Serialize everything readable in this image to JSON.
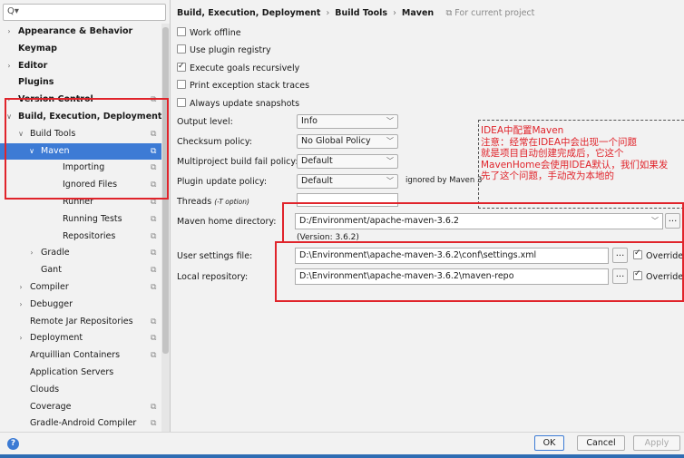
{
  "search": {
    "icon": "search-icon",
    "value": ""
  },
  "tree": [
    {
      "label": "Appearance & Behavior",
      "indent": 0,
      "arrow": "right",
      "bold": true
    },
    {
      "label": "Keymap",
      "indent": 0,
      "arrow": "",
      "bold": true
    },
    {
      "label": "Editor",
      "indent": 0,
      "arrow": "right",
      "bold": true
    },
    {
      "label": "Plugins",
      "indent": 0,
      "arrow": "",
      "bold": true
    },
    {
      "label": "Version Control",
      "indent": 0,
      "arrow": "right",
      "bold": true,
      "page_icon": true
    },
    {
      "label": "Build, Execution, Deployment",
      "indent": 0,
      "arrow": "down",
      "bold": true
    },
    {
      "label": "Build Tools",
      "indent": 1,
      "arrow": "down",
      "page_icon": true
    },
    {
      "label": "Maven",
      "indent": 2,
      "arrow": "down",
      "page_icon": true,
      "selected": true
    },
    {
      "label": "Importing",
      "indent": 3,
      "arrow": "",
      "page_icon": true
    },
    {
      "label": "Ignored Files",
      "indent": 3,
      "arrow": "",
      "page_icon": true
    },
    {
      "label": "Runner",
      "indent": 3,
      "arrow": "",
      "page_icon": true
    },
    {
      "label": "Running Tests",
      "indent": 3,
      "arrow": "",
      "page_icon": true
    },
    {
      "label": "Repositories",
      "indent": 3,
      "arrow": "",
      "page_icon": true
    },
    {
      "label": "Gradle",
      "indent": 2,
      "arrow": "right",
      "page_icon": true
    },
    {
      "label": "Gant",
      "indent": 2,
      "arrow": "",
      "page_icon": true
    },
    {
      "label": "Compiler",
      "indent": 1,
      "arrow": "right",
      "page_icon": true
    },
    {
      "label": "Debugger",
      "indent": 1,
      "arrow": "right"
    },
    {
      "label": "Remote Jar Repositories",
      "indent": 1,
      "arrow": "",
      "page_icon": true
    },
    {
      "label": "Deployment",
      "indent": 1,
      "arrow": "right",
      "page_icon": true
    },
    {
      "label": "Arquillian Containers",
      "indent": 1,
      "arrow": "",
      "page_icon": true
    },
    {
      "label": "Application Servers",
      "indent": 1,
      "arrow": ""
    },
    {
      "label": "Clouds",
      "indent": 1,
      "arrow": ""
    },
    {
      "label": "Coverage",
      "indent": 1,
      "arrow": "",
      "page_icon": true
    },
    {
      "label": "Gradle-Android Compiler",
      "indent": 1,
      "arrow": "",
      "page_icon": true
    }
  ],
  "breadcrumb": {
    "items": [
      "Build, Execution, Deployment",
      "Build Tools",
      "Maven"
    ],
    "scope": "For current project",
    "scope_icon": "project-icon"
  },
  "options": [
    {
      "label": "Work offline",
      "checked": false
    },
    {
      "label": "Use plugin registry",
      "checked": false
    },
    {
      "label": "Execute goals recursively",
      "checked": true
    },
    {
      "label": "Print exception stack traces",
      "checked": false
    },
    {
      "label": "Always update snapshots",
      "checked": false
    }
  ],
  "selects": [
    {
      "label": "Output level:",
      "value": "Info"
    },
    {
      "label": "Checksum policy:",
      "value": "No Global Policy"
    },
    {
      "label": "Multiproject build fail policy:",
      "value": "Default"
    },
    {
      "label": "Plugin update policy:",
      "value": "Default"
    }
  ],
  "ignored_text": "ignored by Maven 3",
  "threads": {
    "label": "Threads",
    "hint": "(-T option)",
    "value": ""
  },
  "maven_home": {
    "label": "Maven home directory:",
    "value": "D:/Environment/apache-maven-3.6.2",
    "version": "(Version: 3.6.2)"
  },
  "user_settings": {
    "label": "User settings file:",
    "value": "D:\\Environment\\apache-maven-3.6.2\\conf\\settings.xml",
    "override_label": "Override",
    "override": true
  },
  "local_repo": {
    "label": "Local repository:",
    "value": "D:\\Environment\\apache-maven-3.6.2\\maven-repo",
    "override_label": "Override",
    "override": true
  },
  "browse_label": "...",
  "annotation": "IDEA中配置Maven\n注意：经常在IDEA中会出现一个问题\n就是项目自动创建完成后，它这个\nMavenHome会使用IDEA默认，我们如果发\n先了这个问题，手动改为本地的",
  "buttons": {
    "ok": "OK",
    "cancel": "Cancel",
    "apply": "Apply"
  },
  "help_label": "?",
  "colors": {
    "accent": "#3d7bd5",
    "highlight_box": "#e0242b",
    "annotation_text": "#e0242b"
  }
}
